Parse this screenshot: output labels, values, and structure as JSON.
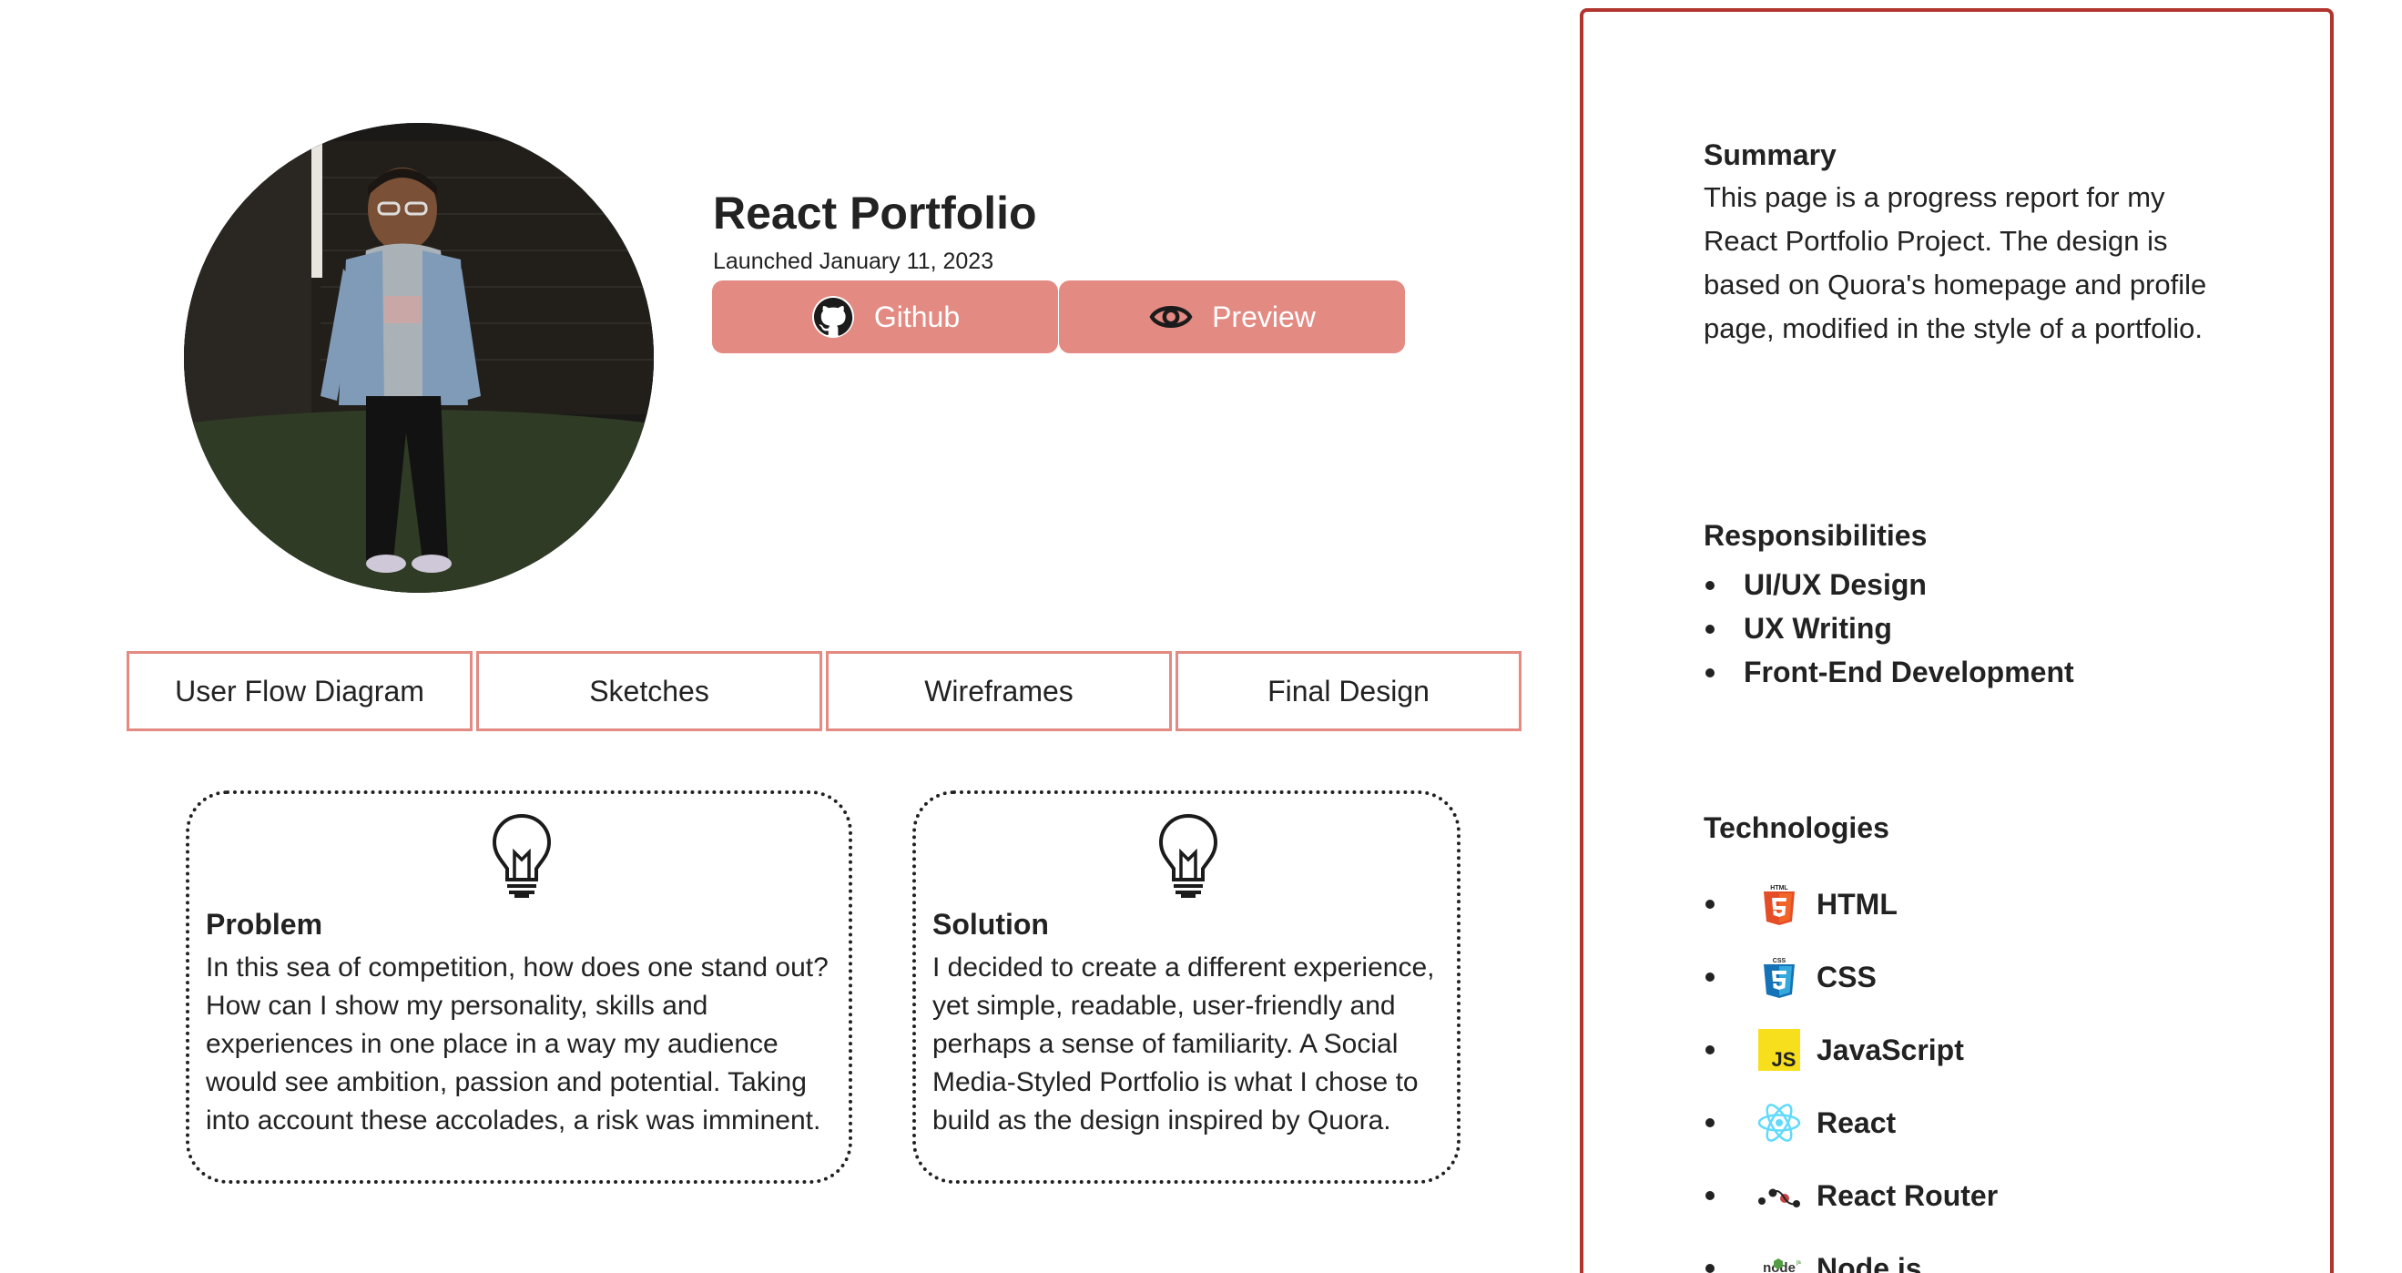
{
  "project": {
    "title": "React Portfolio",
    "launch_date": "Launched January 11, 2023"
  },
  "actions": {
    "github_label": "Github",
    "preview_label": "Preview"
  },
  "tabs": [
    "User Flow Diagram",
    "Sketches",
    "Wireframes",
    "Final Design"
  ],
  "cards": {
    "problem": {
      "title": "Problem",
      "body": "In this sea of competition, how does one stand out? How can I show my personality, skills and experiences in one place in a way my audience would see ambition, passion and potential. Taking into account these accolades, a risk was imminent.",
      "icon": "lightbulb-icon"
    },
    "solution": {
      "title": "Solution",
      "body": "I decided to create a different experience, yet simple, readable, user-friendly and perhaps a sense of familiarity. A Social Media-Styled Portfolio is what I chose to build as the design inspired by Quora.",
      "icon": "lightbulb-icon"
    }
  },
  "sidebar": {
    "summary": {
      "heading": "Summary",
      "text": "This page is a progress report for my React Portfolio Project. The design is based on Quora's homepage and profile page, modified in the style of a portfolio."
    },
    "responsibilities": {
      "heading": "Responsibilities",
      "items": [
        "UI/UX Design",
        "UX Writing",
        "Front-End Development"
      ]
    },
    "technologies": {
      "heading": "Technologies",
      "items": [
        {
          "label": "HTML",
          "icon": "html5-icon"
        },
        {
          "label": "CSS",
          "icon": "css3-icon"
        },
        {
          "label": "JavaScript",
          "icon": "javascript-icon"
        },
        {
          "label": "React",
          "icon": "react-icon"
        },
        {
          "label": "React Router",
          "icon": "react-router-icon"
        },
        {
          "label": "Node.js",
          "icon": "nodejs-icon"
        }
      ]
    }
  },
  "colors": {
    "accent": "#e38a82",
    "sidebar_border": "#b1342e",
    "text": "#222222"
  }
}
